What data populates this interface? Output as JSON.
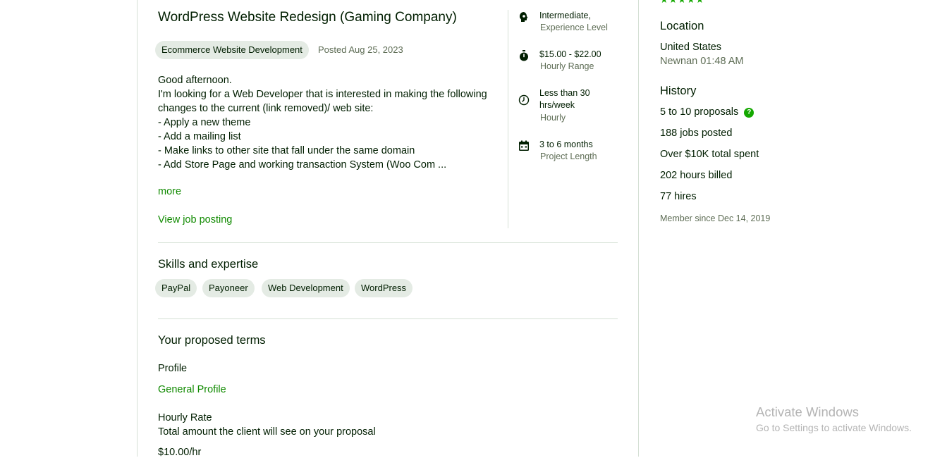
{
  "job": {
    "title": "WordPress Website Redesign (Gaming Company)",
    "category": "Ecommerce Website Development",
    "posted": "Posted Aug 25, 2023",
    "description": [
      "Good afternoon.",
      "I'm looking for a Web Developer that is interested in making the following",
      "changes to the current (link removed)/ web site:",
      "- Apply a new theme",
      "- Add a mailing list",
      "- Make links to other site that fall under the same domain",
      "- Add Store Page and working transaction System (Woo Com ..."
    ],
    "more_label": "more",
    "view_posting_label": "View job posting"
  },
  "features": [
    {
      "icon": "brain-icon",
      "value": "Intermediate,",
      "label": "Experience Level"
    },
    {
      "icon": "stopwatch-icon",
      "value": "$15.00 - $22.00",
      "label": "Hourly Range"
    },
    {
      "icon": "clock-icon",
      "value": "Less than 30 hrs/week",
      "label": "Hourly"
    },
    {
      "icon": "calendar-icon",
      "value": "3 to 6 months",
      "label": "Project Length"
    }
  ],
  "skills": {
    "heading": "Skills and expertise",
    "items": [
      "PayPal",
      "Payoneer",
      "Web Development",
      "WordPress"
    ]
  },
  "terms": {
    "heading": "Your proposed terms",
    "profile_heading": "Profile",
    "profile_value": "General Profile",
    "rate_heading": "Hourly Rate",
    "rate_sub": "Total amount the client will see on your proposal",
    "rate_value": "$10.00/hr"
  },
  "client": {
    "location_heading": "Location",
    "country": "United States",
    "city_time": "Newnan 01:48 AM",
    "history_heading": "History",
    "proposals": "5 to 10 proposals",
    "jobs_posted": "188 jobs posted",
    "total_spent": "Over $10K total spent",
    "hours_billed": "202 hours billed",
    "hires": "77 hires",
    "member_since": "Member since Dec 14, 2019"
  },
  "watermark": {
    "line1": "Activate Windows",
    "line2": "Go to Settings to activate Windows."
  },
  "colors": {
    "accent": "#108a00",
    "chip_bg": "#e4ebe4",
    "text": "#001e00",
    "muted": "#5e6d55"
  }
}
